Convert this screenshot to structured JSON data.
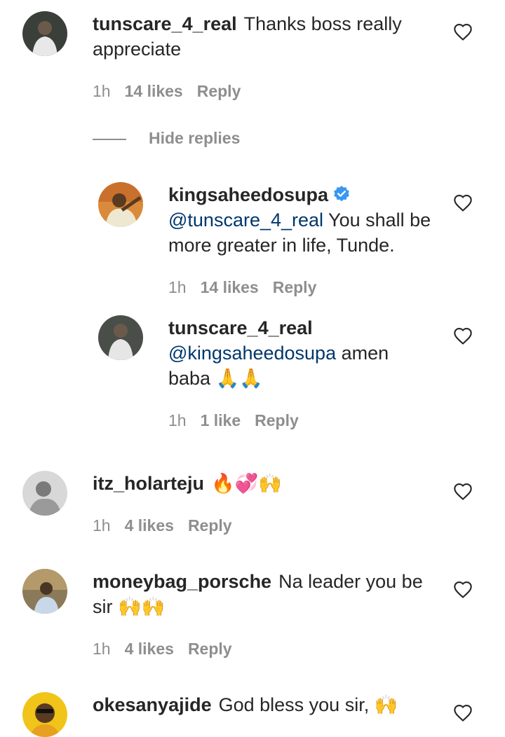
{
  "comments": [
    {
      "username": "tunscare_4_real",
      "text": "Thanks boss really appreciate",
      "time": "1h",
      "likes": "14 likes",
      "reply": "Reply"
    },
    {
      "username": "itz_holarteju",
      "text": "🔥💞🙌",
      "time": "1h",
      "likes": "4 likes",
      "reply": "Reply"
    },
    {
      "username": "moneybag_porsche",
      "text": "Na leader you be sir 🙌🙌",
      "time": "1h",
      "likes": "4 likes",
      "reply": "Reply"
    },
    {
      "username": "okesanyajide",
      "text": "God bless you sir, 🙌"
    }
  ],
  "hide_replies": "Hide replies",
  "replies": [
    {
      "username": "kingsaheedosupa",
      "mention": "@tunscare_4_real",
      "text": " You shall be more greater in life, Tunde.",
      "time": "1h",
      "likes": "14 likes",
      "reply": "Reply"
    },
    {
      "username": "tunscare_4_real",
      "mention": "@kingsaheedosupa",
      "text": " amen baba 🙏🙏",
      "time": "1h",
      "likes": "1 like",
      "reply": "Reply"
    }
  ],
  "colors": {
    "text": "#262626",
    "meta": "#8e8e8e",
    "mention": "#00376b",
    "verified": "#3897f0"
  },
  "icons": {
    "like": "heart-outline-icon",
    "verified": "verified-badge-icon"
  }
}
